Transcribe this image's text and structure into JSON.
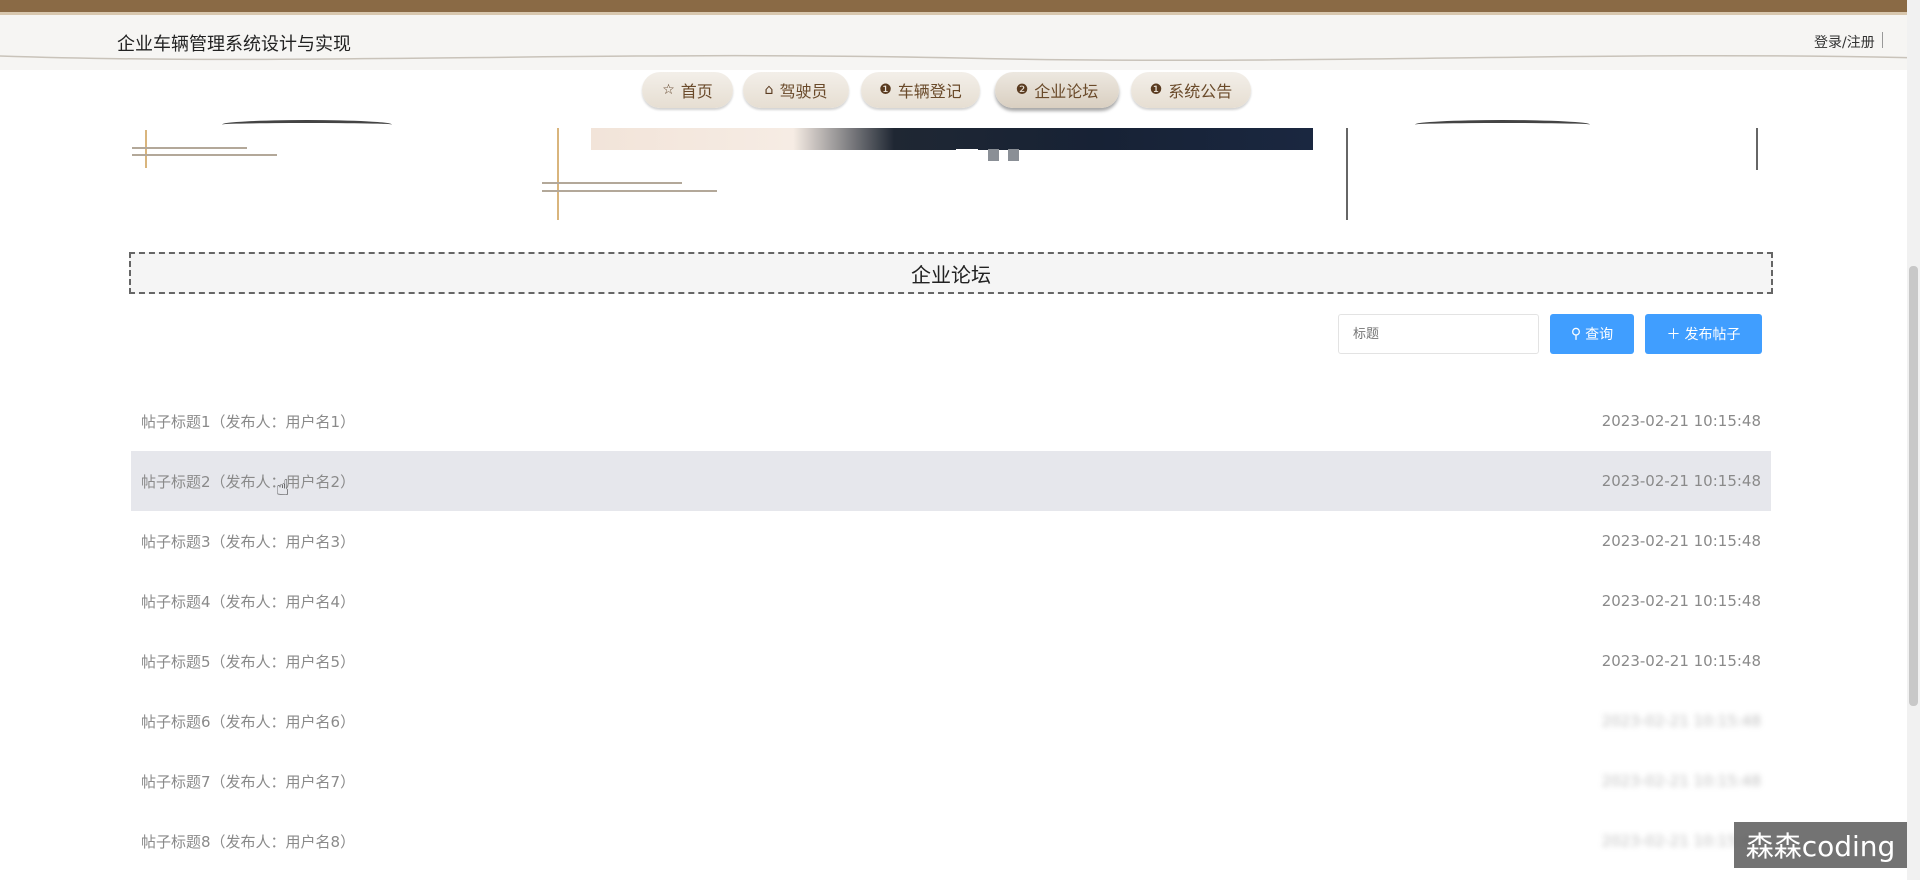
{
  "header": {
    "site_title": "企业车辆管理系统设计与实现",
    "login_label": "登录/注册"
  },
  "nav": {
    "items": [
      {
        "icon": "star-icon",
        "glyph": "☆",
        "label": "首页"
      },
      {
        "icon": "bag-icon",
        "glyph": "⌂",
        "label": "驾驶员"
      },
      {
        "icon": "info-icon",
        "glyph": "❶",
        "label": "车辆登记"
      },
      {
        "icon": "question-icon",
        "glyph": "❷",
        "label": "企业论坛"
      },
      {
        "icon": "info-icon",
        "glyph": "❶",
        "label": "系统公告"
      }
    ],
    "active_index": 3
  },
  "banner": {
    "dots": 3,
    "active_dot": 0
  },
  "section": {
    "title": "企业论坛"
  },
  "search": {
    "placeholder": "标题",
    "query_button": "查询",
    "publish_button": "发布帖子",
    "query_icon": "search-icon",
    "publish_icon": "plus-icon"
  },
  "posts": [
    {
      "title": "帖子标题1（发布人：用户名1）",
      "date": "2023-02-21 10:15:48"
    },
    {
      "title": "帖子标题2（发布人：用户名2）",
      "date": "2023-02-21 10:15:48"
    },
    {
      "title": "帖子标题3（发布人：用户名3）",
      "date": "2023-02-21 10:15:48"
    },
    {
      "title": "帖子标题4（发布人：用户名4）",
      "date": "2023-02-21 10:15:48"
    },
    {
      "title": "帖子标题5（发布人：用户名5）",
      "date": "2023-02-21 10:15:48"
    },
    {
      "title": "帖子标题6（发布人：用户名6）",
      "date": "2023-02-21 10:15:48"
    },
    {
      "title": "帖子标题7（发布人：用户名7）",
      "date": "2023-02-21 10:15:48"
    },
    {
      "title": "帖子标题8（发布人：用户名8）",
      "date": "2023-02-21 10:15:48"
    }
  ],
  "watermark": "森森coding",
  "colors": {
    "accent": "#409eff",
    "header_stripe": "#8a6a45",
    "nav_text": "#6a4a2a",
    "row_hover": "#e6e7ec"
  }
}
